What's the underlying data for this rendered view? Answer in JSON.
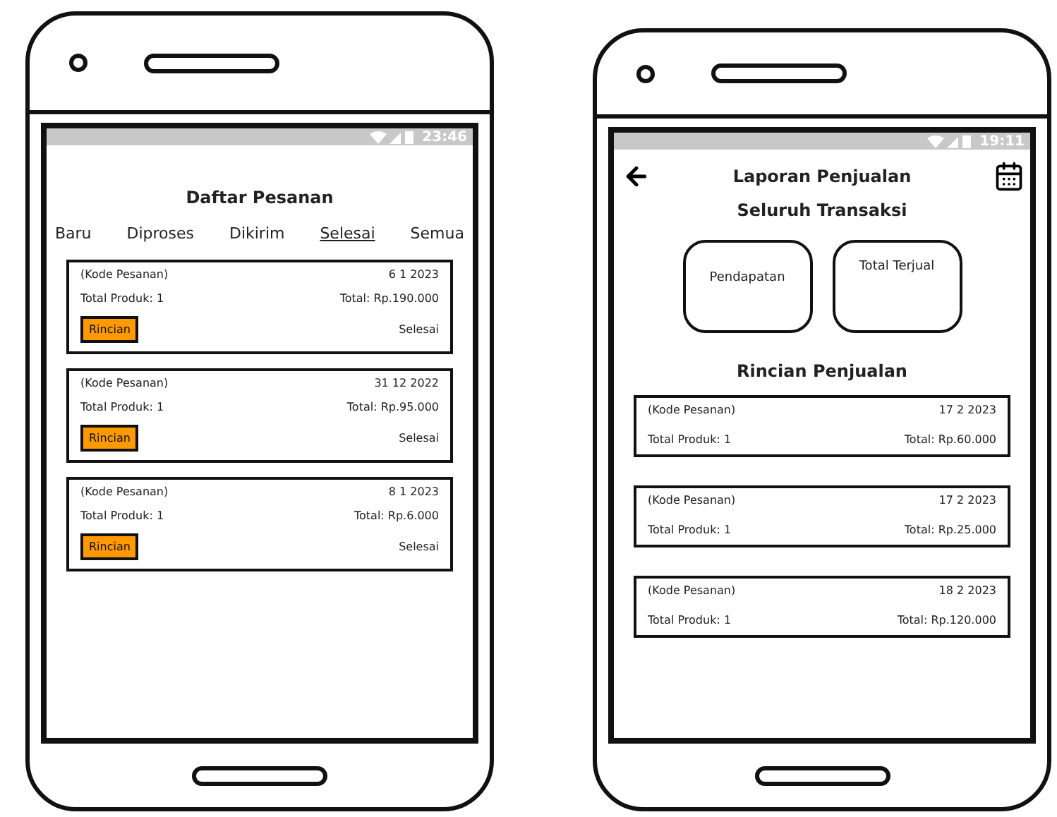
{
  "phones": [
    {
      "kind": "orders",
      "status_bar": {
        "time": "23:46"
      },
      "title": "Daftar Pesanan",
      "tabs": [
        {
          "label": "Baru",
          "selected": false
        },
        {
          "label": "Diproses",
          "selected": false
        },
        {
          "label": "Dikirim",
          "selected": false
        },
        {
          "label": "Selesai",
          "selected": true
        },
        {
          "label": "Semua",
          "selected": false
        }
      ],
      "orders": [
        {
          "code": "(Kode Pesanan)",
          "date": "6 1 2023",
          "products": "Total Produk: 1",
          "total": "Total: Rp.190.000",
          "button": "Rincian",
          "status": "Selesai"
        },
        {
          "code": "(Kode Pesanan)",
          "date": "31 12 2022",
          "products": "Total Produk: 1",
          "total": "Total: Rp.95.000",
          "button": "Rincian",
          "status": "Selesai"
        },
        {
          "code": "(Kode Pesanan)",
          "date": "8 1 2023",
          "products": "Total Produk: 1",
          "total": "Total: Rp.6.000",
          "button": "Rincian",
          "status": "Selesai"
        }
      ]
    },
    {
      "kind": "report",
      "status_bar": {
        "time": "19:11"
      },
      "title": "Laporan Penjualan",
      "subtitle": "Seluruh Transaksi",
      "summary_cards": [
        "Pendapatan",
        "Total Terjual"
      ],
      "section_title": "Rincian Penjualan",
      "sales": [
        {
          "code": "(Kode Pesanan)",
          "date": "17 2 2023",
          "products": "Total Produk: 1",
          "total": "Total: Rp.60.000"
        },
        {
          "code": "(Kode Pesanan)",
          "date": "17 2 2023",
          "products": "Total Produk: 1",
          "total": "Total: Rp.25.000"
        },
        {
          "code": "(Kode Pesanan)",
          "date": "18 2 2023",
          "products": "Total Produk: 1",
          "total": "Total: Rp.120.000"
        }
      ]
    }
  ]
}
